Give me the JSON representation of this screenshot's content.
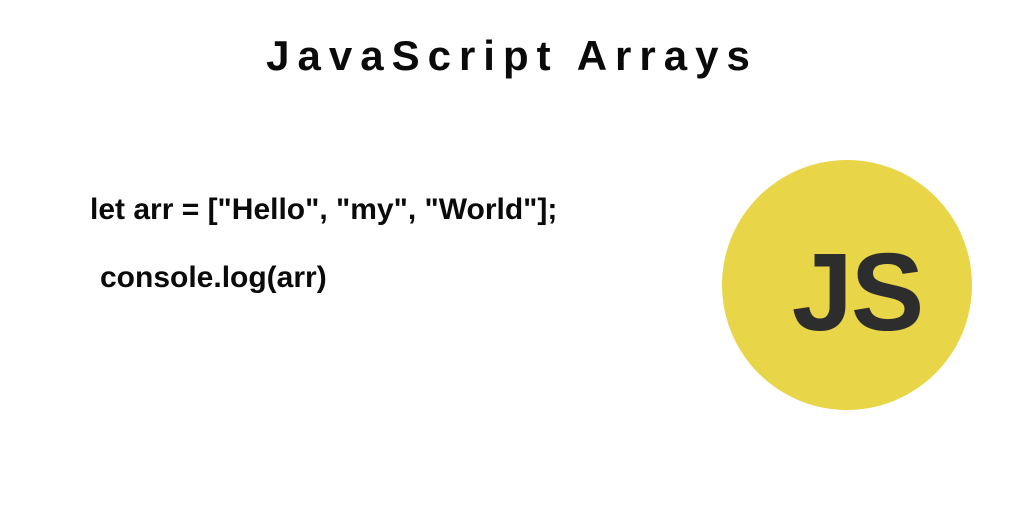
{
  "title": "JavaScript Arrays",
  "code": {
    "line1": "let arr = [\"Hello\", \"my\", \"World\"];",
    "line2": "console.log(arr)"
  },
  "logo": {
    "text": "JS"
  }
}
